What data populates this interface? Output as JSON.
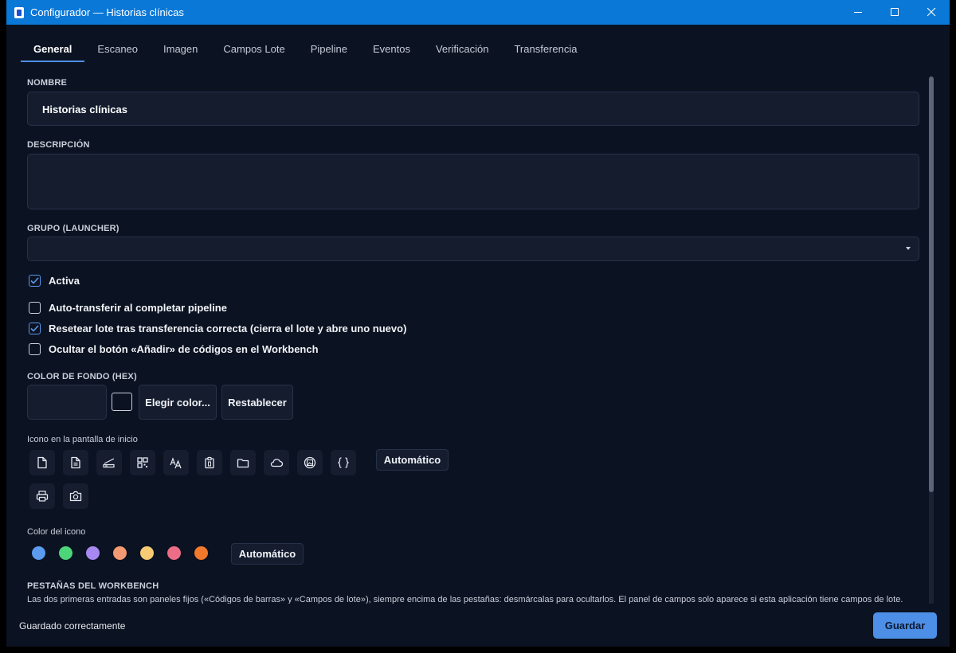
{
  "window": {
    "title": "Configurador — Historias clínicas"
  },
  "tabs": [
    {
      "label": "General",
      "active": true
    },
    {
      "label": "Escaneo"
    },
    {
      "label": "Imagen"
    },
    {
      "label": "Campos Lote"
    },
    {
      "label": "Pipeline"
    },
    {
      "label": "Eventos"
    },
    {
      "label": "Verificación"
    },
    {
      "label": "Transferencia"
    }
  ],
  "form": {
    "name_label": "NOMBRE",
    "name_value": "Historias clínicas",
    "description_label": "DESCRIPCIÓN",
    "description_value": "",
    "group_label": "GRUPO (LAUNCHER)",
    "group_value": "",
    "checks": [
      {
        "label": "Activa",
        "checked": true
      },
      {
        "label": "Auto-transferir al completar pipeline",
        "checked": false
      },
      {
        "label": "Resetear lote tras transferencia correcta (cierra el lote y abre uno nuevo)",
        "checked": true
      },
      {
        "label": "Ocultar el botón «Añadir» de códigos en el Workbench",
        "checked": false
      }
    ],
    "bg_color_label": "COLOR DE FONDO (HEX)",
    "bg_color_value": "",
    "pick_color_label": "Elegir color...",
    "reset_label": "Restablecer",
    "home_icon_label": "Icono en la pantalla de inicio",
    "home_icons": [
      "file-icon",
      "document-icon",
      "scanner-icon",
      "qr-code-icon",
      "text-recognition-icon",
      "clipboard-icon",
      "folder-icon",
      "cloud-icon",
      "image-icon",
      "code-braces-icon",
      "printer-icon",
      "camera-icon"
    ],
    "home_icon_auto_label": "Automático",
    "icon_color_label": "Color del icono",
    "icon_colors": [
      "#5b9cf0",
      "#4dd57a",
      "#a788f0",
      "#f49a72",
      "#f6cb74",
      "#ec6e86",
      "#f37a2c"
    ],
    "icon_color_auto_label": "Automático",
    "workbench_tabs_label": "PESTAÑAS DEL WORKBENCH",
    "workbench_help": "Las dos primeras entradas son paneles fijos («Códigos de barras» y «Campos de lote»), siempre encima de las pestañas: desmárcalas para ocultarlos. El panel de campos solo aparece si esta aplicación tiene campos de lote."
  },
  "footer": {
    "status": "Guardado correctamente",
    "save_label": "Guardar"
  }
}
